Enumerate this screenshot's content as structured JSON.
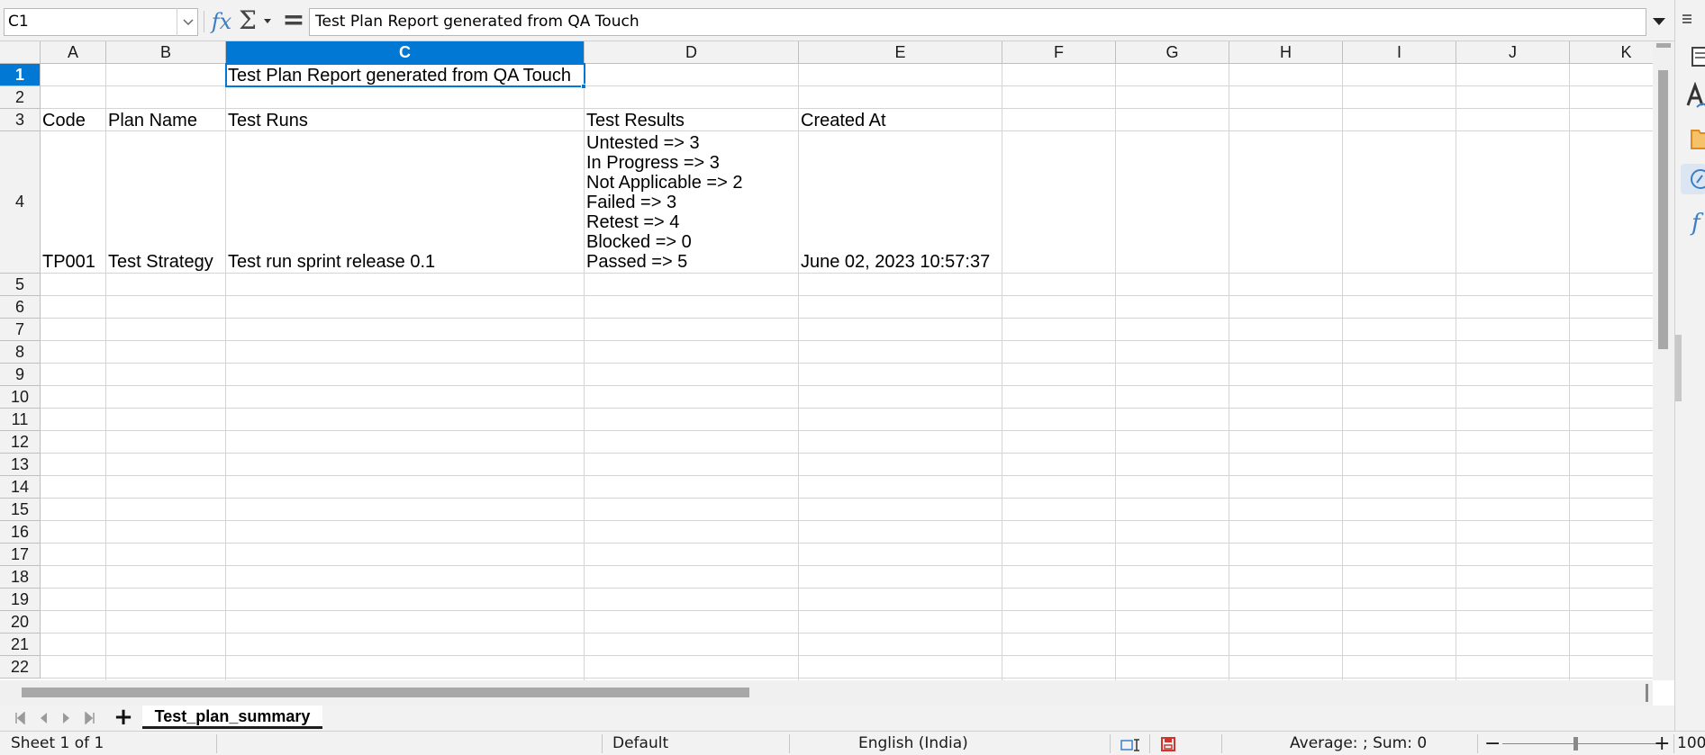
{
  "formula_bar": {
    "name_box": "C1",
    "formula": "Test Plan Report generated from QA Touch",
    "icons": [
      "fx-icon",
      "sigma-icon",
      "equals-icon"
    ]
  },
  "columns": [
    "A",
    "B",
    "C",
    "D",
    "E",
    "F",
    "G",
    "H",
    "I",
    "J",
    "K"
  ],
  "selected_column": "C",
  "rows": [
    "1",
    "2",
    "3",
    "4",
    "5",
    "6",
    "7",
    "8",
    "9",
    "10",
    "11",
    "12",
    "13",
    "14",
    "15",
    "16",
    "17",
    "18",
    "19",
    "20",
    "21",
    "22"
  ],
  "selected_row": "1",
  "cells": {
    "C1": "Test Plan Report generated from QA Touch",
    "A3": "Code",
    "B3": "Plan Name",
    "C3": "Test Runs",
    "D3": "Test Results",
    "E3": "Created At",
    "A4": "TP001",
    "B4": "Test Strategy",
    "C4": "Test run sprint release 0.1",
    "D4": [
      "Untested => 3",
      "In Progress => 3",
      "Not Applicable => 2",
      "Failed => 3",
      "Retest => 4",
      "Blocked => 0",
      "Passed => 5"
    ],
    "E4": "June 02, 2023 10:57:37"
  },
  "sheet_tabs": {
    "active": "Test_plan_summary"
  },
  "status_bar": {
    "sheet_info": "Sheet 1 of 1",
    "page_style": "Default",
    "language": "English (India)",
    "summary": "Average: ; Sum: 0",
    "zoom": "100"
  },
  "colors": {
    "selection": "#0078d4",
    "header_bg": "#f2f2f2",
    "grid_line": "#d4d4d4"
  }
}
